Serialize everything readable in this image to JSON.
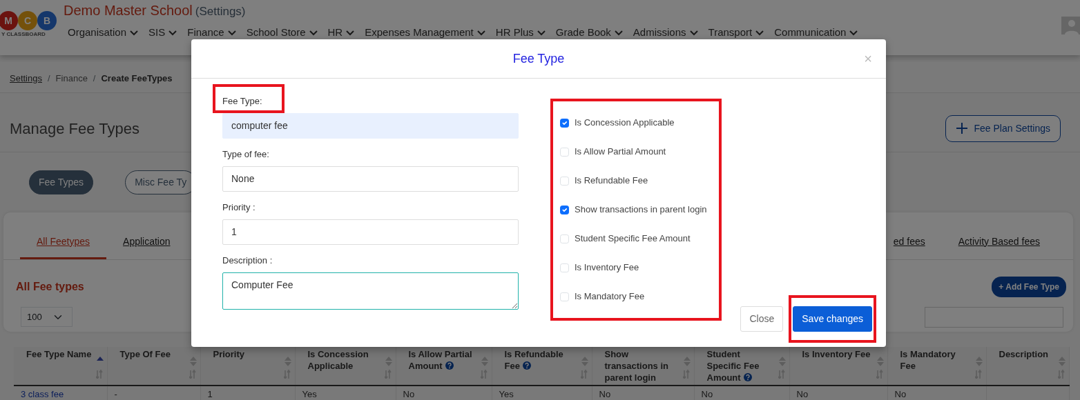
{
  "header": {
    "logo_letters": [
      "M",
      "C",
      "B"
    ],
    "logo_caption": "Y CLASSBOARD",
    "school": "Demo Master School",
    "context": "(Settings)"
  },
  "nav": [
    "Organisation",
    "SIS",
    "Finance",
    "School Store",
    "HR",
    "Expenses Management",
    "HR Plus",
    "Grade Book",
    "Admissions",
    "Transport",
    "Communication"
  ],
  "breadcrumb_separator": "/",
  "breadcrumb": [
    {
      "label": "Settings",
      "kind": "link"
    },
    {
      "label": "Finance",
      "kind": "plain"
    },
    {
      "label": "Create FeeTypes",
      "kind": "current"
    }
  ],
  "page_title": "Manage Fee Types",
  "header_buttons": [
    "Fee Plan Settings"
  ],
  "pills": [
    {
      "label": "Fee Types",
      "selected": true
    },
    {
      "label": "Misc Fee Ty",
      "selected": false
    }
  ],
  "tabs": [
    {
      "label": "All Feetypes",
      "selected": true
    },
    {
      "label": "Application",
      "selected": false
    },
    {
      "label": "ed fees",
      "selected": false
    },
    {
      "label": "Activity Based fees",
      "selected": false
    }
  ],
  "list_title": "All Fee types",
  "add_button": "+ Add Fee Type",
  "page_size": "100",
  "table": {
    "columns": [
      {
        "label": "Fee Type Name",
        "sorted": true,
        "help": false
      },
      {
        "label": "Type Of Fee",
        "sorted": false,
        "help": false
      },
      {
        "label": "Priority",
        "sorted": false,
        "help": false
      },
      {
        "label": "Is Concession Applicable",
        "sorted": false,
        "help": false
      },
      {
        "label": "Is Allow Partial Amount",
        "sorted": false,
        "help": true
      },
      {
        "label": "Is Refundable Fee",
        "sorted": false,
        "help": true
      },
      {
        "label": "Show transactions in parent login",
        "sorted": false,
        "help": false
      },
      {
        "label": "Student Specific Fee Amount",
        "sorted": false,
        "help": true
      },
      {
        "label": "Is Inventory Fee",
        "sorted": false,
        "help": false
      },
      {
        "label": "Is Mandatory Fee",
        "sorted": false,
        "help": false
      },
      {
        "label": "Description",
        "sorted": false,
        "help": false
      }
    ],
    "rows": [
      [
        "3 class fee",
        "-",
        "1",
        "Yes",
        "No",
        "Yes",
        "No",
        "No",
        "No",
        "No"
      ]
    ]
  },
  "modal": {
    "title": "Fee Type",
    "close_glyph": "×",
    "fields": [
      {
        "kind": "input",
        "label": "Fee Type:",
        "value": "computer fee",
        "autofilled": true,
        "highlighted": true
      },
      {
        "kind": "select",
        "label": "Type of fee:",
        "value": "None",
        "autofilled": false,
        "highlighted": false
      },
      {
        "kind": "input",
        "label": "Priority :",
        "value": "1",
        "autofilled": false,
        "highlighted": false
      },
      {
        "kind": "textarea",
        "label": "Description :",
        "value": "Computer Fee",
        "autofilled": false,
        "highlighted": false
      }
    ],
    "checks_highlighted": true,
    "checks": [
      {
        "label": "Is Concession Applicable",
        "checked": true
      },
      {
        "label": "Is Allow Partial Amount",
        "checked": false
      },
      {
        "label": "Is Refundable Fee",
        "checked": false
      },
      {
        "label": "Show transactions in parent login",
        "checked": true
      },
      {
        "label": "Student Specific Fee Amount",
        "checked": false
      },
      {
        "label": "Is Inventory Fee",
        "checked": false
      },
      {
        "label": "Is Mandatory Fee",
        "checked": false
      }
    ],
    "buttons": [
      {
        "label": "Close",
        "kind": "secondary",
        "highlighted": false
      },
      {
        "label": "Save changes",
        "kind": "primary",
        "highlighted": true
      }
    ]
  }
}
